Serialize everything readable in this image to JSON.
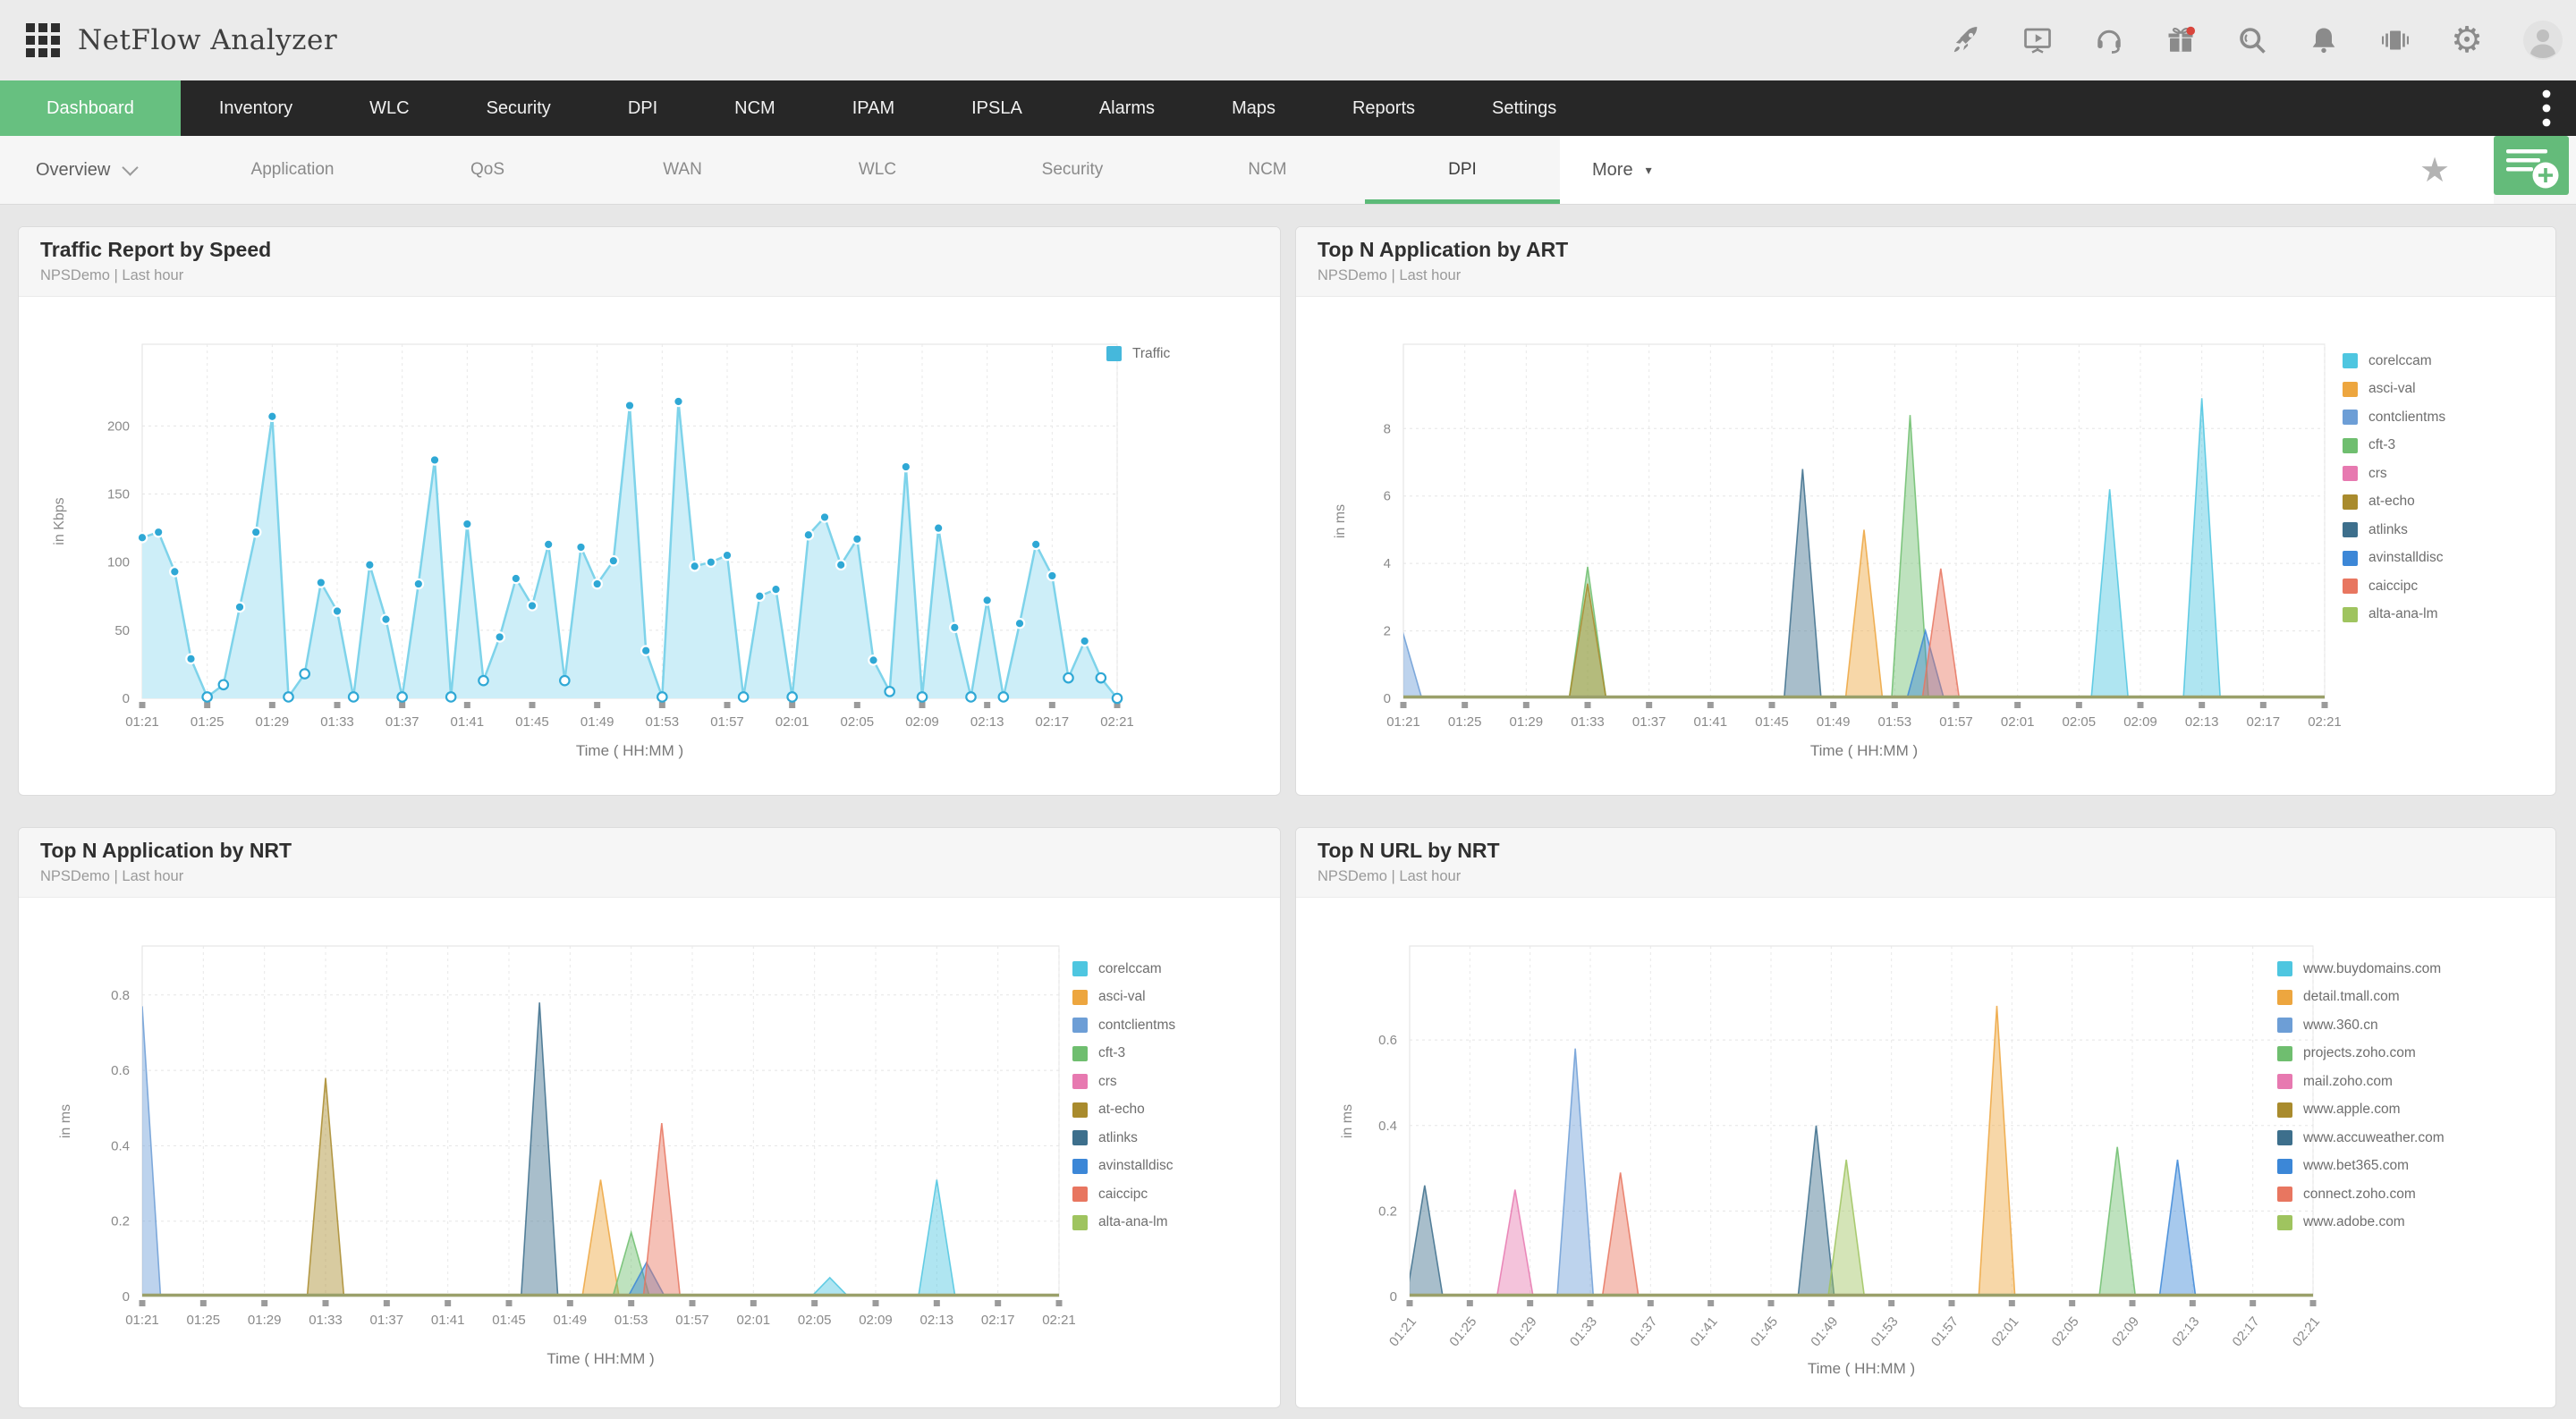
{
  "app": {
    "title": "NetFlow Analyzer"
  },
  "topbar": {
    "icons": [
      "rocket-icon",
      "training-video-icon",
      "support-headset-icon",
      "whats-new-gift-icon",
      "search-icon",
      "notifications-bell-icon",
      "product-switcher-icon",
      "settings-gear-icon",
      "user-avatar"
    ]
  },
  "nav": {
    "items": [
      "Dashboard",
      "Inventory",
      "WLC",
      "Security",
      "DPI",
      "NCM",
      "IPAM",
      "IPSLA",
      "Alarms",
      "Maps",
      "Reports",
      "Settings"
    ],
    "active": "Dashboard"
  },
  "subnav": {
    "overview_label": "Overview",
    "tabs": [
      "Application",
      "QoS",
      "WAN",
      "WLC",
      "Security",
      "NCM",
      "DPI"
    ],
    "active_tab": "DPI",
    "more_label": "More",
    "star_icon": "★"
  },
  "colors": {
    "green_active": "#67c080",
    "green_underline": "#5cba78",
    "baseline_olive": "#9aa06a",
    "traffic_line": "#7ed3ea",
    "traffic_fill": "#cdeef8",
    "traffic_marker": "#2fa8d5"
  },
  "panels": [
    {
      "title": "Traffic Report by Speed",
      "subtitle": "NPSDemo | Last hour"
    },
    {
      "title": "Top N Application by ART",
      "subtitle": "NPSDemo | Last hour"
    },
    {
      "title": "Top N Application by NRT",
      "subtitle": "NPSDemo | Last hour"
    },
    {
      "title": "Top N URL by NRT",
      "subtitle": "NPSDemo | Last hour"
    }
  ],
  "chart_data": [
    {
      "type": "area",
      "title": "Traffic Report by Speed",
      "xlabel": "Time ( HH:MM )",
      "ylabel": "in Kbps",
      "yticks": [
        0,
        50,
        100,
        150,
        200
      ],
      "ylim": [
        0,
        260
      ],
      "x_ticks": [
        "01:21",
        "01:25",
        "01:29",
        "01:33",
        "01:37",
        "01:41",
        "01:45",
        "01:49",
        "01:53",
        "01:57",
        "02:01",
        "02:05",
        "02:09",
        "02:13",
        "02:17",
        "02:21"
      ],
      "x_interval_minutes": 1,
      "legend": [
        {
          "name": "Traffic",
          "color": "#45b8dc"
        }
      ],
      "values": [
        118,
        122,
        93,
        29,
        1,
        10,
        67,
        122,
        207,
        1,
        18,
        85,
        64,
        1,
        98,
        58,
        1,
        84,
        175,
        1,
        128,
        13,
        45,
        88,
        68,
        113,
        13,
        111,
        84,
        101,
        215,
        35,
        1,
        218,
        97,
        100,
        105,
        1,
        75,
        80,
        1,
        120,
        133,
        98,
        117,
        28,
        5,
        170,
        1,
        125,
        52,
        1,
        72,
        1,
        55,
        113,
        90,
        15,
        42,
        15,
        0
      ]
    },
    {
      "type": "spike-area",
      "title": "Top N Application by ART",
      "xlabel": "Time ( HH:MM )",
      "ylabel": "in ms",
      "yticks": [
        0,
        2,
        4,
        6,
        8
      ],
      "ylim": [
        0,
        10.5
      ],
      "x_ticks": [
        "01:21",
        "01:25",
        "01:29",
        "01:33",
        "01:37",
        "01:41",
        "01:45",
        "01:49",
        "01:53",
        "01:57",
        "02:01",
        "02:05",
        "02:09",
        "02:13",
        "02:17",
        "02:21"
      ],
      "series": [
        {
          "name": "corelccam",
          "color": "#4ec6e0",
          "spikes": [
            [
              46,
              6.2
            ],
            [
              52,
              8.9
            ]
          ]
        },
        {
          "name": "asci-val",
          "color": "#eda63f",
          "spikes": [
            [
              30,
              5.0
            ]
          ]
        },
        {
          "name": "contclientms",
          "color": "#6d9ed6",
          "spikes": [
            [
              0,
              1.9
            ]
          ]
        },
        {
          "name": "cft-3",
          "color": "#6fbe6f",
          "spikes": [
            [
              12,
              3.9
            ],
            [
              33,
              8.4
            ]
          ]
        },
        {
          "name": "crs",
          "color": "#e779b0",
          "spikes": []
        },
        {
          "name": "at-echo",
          "color": "#a98b2d",
          "spikes": [
            [
              12,
              3.4
            ]
          ]
        },
        {
          "name": "atlinks",
          "color": "#3d6f8c",
          "spikes": [
            [
              26,
              6.8
            ]
          ]
        },
        {
          "name": "avinstalldisc",
          "color": "#3c87d7",
          "spikes": [
            [
              34,
              2.0
            ]
          ]
        },
        {
          "name": "caiccipc",
          "color": "#e87660",
          "spikes": [
            [
              35,
              3.85
            ]
          ]
        },
        {
          "name": "alta-ana-lm",
          "color": "#9fc45f",
          "spikes": []
        }
      ]
    },
    {
      "type": "spike-area",
      "title": "Top N Application by NRT",
      "xlabel": "Time ( HH:MM )",
      "ylabel": "in ms",
      "yticks": [
        0,
        0.2,
        0.4,
        0.6,
        0.8
      ],
      "ylim": [
        0,
        0.93
      ],
      "x_ticks": [
        "01:21",
        "01:25",
        "01:29",
        "01:33",
        "01:37",
        "01:41",
        "01:45",
        "01:49",
        "01:53",
        "01:57",
        "02:01",
        "02:05",
        "02:09",
        "02:13",
        "02:17",
        "02:21"
      ],
      "series": [
        {
          "name": "corelccam",
          "color": "#4ec6e0",
          "spikes": [
            [
              45,
              0.05
            ],
            [
              52,
              0.31
            ]
          ]
        },
        {
          "name": "asci-val",
          "color": "#eda63f",
          "spikes": [
            [
              30,
              0.31
            ]
          ]
        },
        {
          "name": "contclientms",
          "color": "#6d9ed6",
          "spikes": [
            [
              0,
              0.77
            ]
          ]
        },
        {
          "name": "cft-3",
          "color": "#6fbe6f",
          "spikes": [
            [
              32,
              0.17
            ]
          ]
        },
        {
          "name": "crs",
          "color": "#e779b0",
          "spikes": []
        },
        {
          "name": "at-echo",
          "color": "#a98b2d",
          "spikes": [
            [
              12,
              0.58
            ]
          ]
        },
        {
          "name": "atlinks",
          "color": "#3d6f8c",
          "spikes": [
            [
              26,
              0.78
            ]
          ]
        },
        {
          "name": "avinstalldisc",
          "color": "#3c87d7",
          "spikes": [
            [
              33,
              0.09
            ]
          ]
        },
        {
          "name": "caiccipc",
          "color": "#e87660",
          "spikes": [
            [
              34,
              0.46
            ]
          ]
        },
        {
          "name": "alta-ana-lm",
          "color": "#9fc45f",
          "spikes": []
        }
      ]
    },
    {
      "type": "spike-area",
      "title": "Top N URL by NRT",
      "xlabel": "Time ( HH:MM )",
      "ylabel": "in ms",
      "yticks": [
        0,
        0.2,
        0.4,
        0.6
      ],
      "ylim": [
        0,
        0.82
      ],
      "x_ticks": [
        "01:21",
        "01:25",
        "01:29",
        "01:33",
        "01:37",
        "01:41",
        "01:45",
        "01:49",
        "01:53",
        "01:57",
        "02:01",
        "02:05",
        "02:09",
        "02:13",
        "02:17",
        "02:21"
      ],
      "series": [
        {
          "name": "www.buydomains.com",
          "color": "#4ec6e0",
          "spikes": []
        },
        {
          "name": "detail.tmall.com",
          "color": "#eda63f",
          "spikes": [
            [
              39,
              0.68
            ]
          ]
        },
        {
          "name": "www.360.cn",
          "color": "#6d9ed6",
          "spikes": [
            [
              11,
              0.58
            ]
          ]
        },
        {
          "name": "projects.zoho.com",
          "color": "#6fbe6f",
          "spikes": [
            [
              47,
              0.35
            ]
          ]
        },
        {
          "name": "mail.zoho.com",
          "color": "#e779b0",
          "spikes": [
            [
              7,
              0.25
            ]
          ]
        },
        {
          "name": "www.apple.com",
          "color": "#a98b2d",
          "spikes": []
        },
        {
          "name": "www.accuweather.com",
          "color": "#3d6f8c",
          "spikes": [
            [
              1,
              0.26
            ],
            [
              27,
              0.4
            ]
          ]
        },
        {
          "name": "www.bet365.com",
          "color": "#3c87d7",
          "spikes": [
            [
              51,
              0.32
            ]
          ]
        },
        {
          "name": "connect.zoho.com",
          "color": "#e87660",
          "spikes": [
            [
              14,
              0.29
            ]
          ]
        },
        {
          "name": "www.adobe.com",
          "color": "#9fc45f",
          "spikes": [
            [
              29,
              0.32
            ]
          ]
        }
      ]
    }
  ]
}
